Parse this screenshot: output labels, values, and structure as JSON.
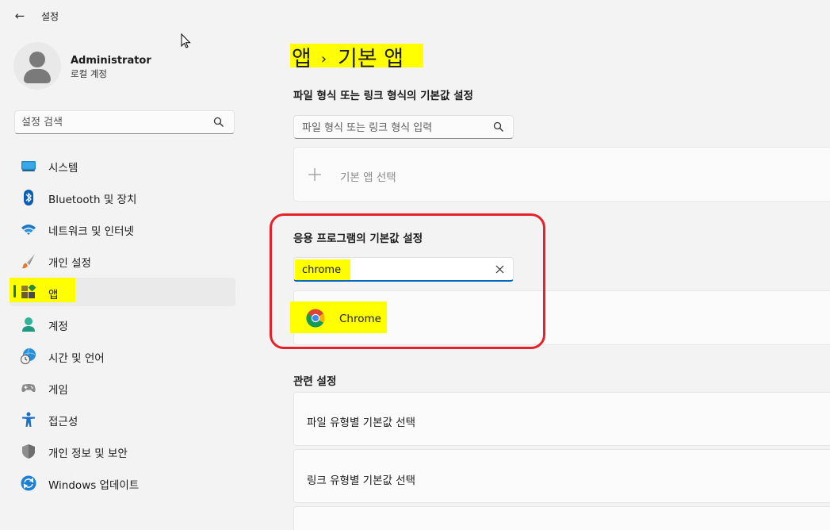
{
  "window": {
    "title": "설정"
  },
  "profile": {
    "name": "Administrator",
    "account_type": "로컬 계정"
  },
  "sidebar": {
    "search_placeholder": "설정 검색",
    "items": [
      {
        "label": "시스템",
        "icon": "system-icon"
      },
      {
        "label": "Bluetooth 및 장치",
        "icon": "bluetooth-icon"
      },
      {
        "label": "네트워크 및 인터넷",
        "icon": "wifi-icon"
      },
      {
        "label": "개인 설정",
        "icon": "brush-icon"
      },
      {
        "label": "앱",
        "icon": "apps-icon",
        "active": true
      },
      {
        "label": "계정",
        "icon": "account-icon"
      },
      {
        "label": "시간 및 언어",
        "icon": "time-language-icon"
      },
      {
        "label": "게임",
        "icon": "gamepad-icon"
      },
      {
        "label": "접근성",
        "icon": "accessibility-icon"
      },
      {
        "label": "개인 정보 및 보안",
        "icon": "shield-icon"
      },
      {
        "label": "Windows 업데이트",
        "icon": "update-icon"
      }
    ]
  },
  "main": {
    "breadcrumb": {
      "parent": "앱",
      "separator": "›",
      "current": "기본 앱"
    },
    "file_link_section": {
      "heading": "파일 형식 또는 링크 형식의 기본값 설정",
      "input_placeholder": "파일 형식 또는 링크 형식 입력",
      "choose_default_label": "기본 앱 선택"
    },
    "app_section": {
      "heading": "응용 프로그램의 기본값 설정",
      "search_value": "chrome",
      "result_app": "Chrome"
    },
    "related": {
      "heading": "관련 설정",
      "items": [
        "파일 유형별 기본값 선택",
        "링크 유형별 기본값 선택"
      ]
    }
  },
  "colors": {
    "highlight": "#ffff00",
    "annotation_outline": "#e8202a",
    "accent": "#0067c0"
  }
}
